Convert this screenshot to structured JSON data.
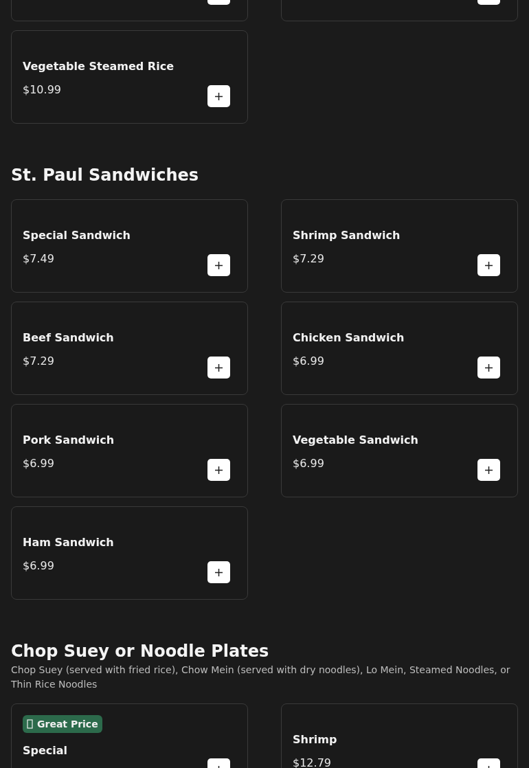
{
  "sections": [
    {
      "items": [
        {
          "kind": "clipped"
        },
        {
          "kind": "clipped"
        },
        {
          "kind": "item",
          "name": "Vegetable Steamed Rice",
          "price": "$10.99"
        }
      ]
    },
    {
      "title": "St. Paul Sandwiches",
      "items": [
        {
          "kind": "item",
          "name": "Special Sandwich",
          "price": "$7.49"
        },
        {
          "kind": "item",
          "name": "Shrimp Sandwich",
          "price": "$7.29"
        },
        {
          "kind": "item",
          "name": "Beef Sandwich",
          "price": "$7.29"
        },
        {
          "kind": "item",
          "name": "Chicken Sandwich",
          "price": "$6.99"
        },
        {
          "kind": "item",
          "name": "Pork Sandwich",
          "price": "$6.99"
        },
        {
          "kind": "item",
          "name": "Vegetable Sandwich",
          "price": "$6.99"
        },
        {
          "kind": "item",
          "name": "Ham Sandwich",
          "price": "$6.99"
        }
      ]
    },
    {
      "title": "Chop Suey or Noodle Plates",
      "description": "Chop Suey (served with fried rice), Chow Mein (served with dry noodles), Lo Mein, Steamed Noodles, or Thin Rice Noodles",
      "items": [
        {
          "kind": "item",
          "badge": "Great Price",
          "name": "Special"
        },
        {
          "kind": "item",
          "name": "Shrimp",
          "price": "$12.79"
        }
      ]
    }
  ]
}
